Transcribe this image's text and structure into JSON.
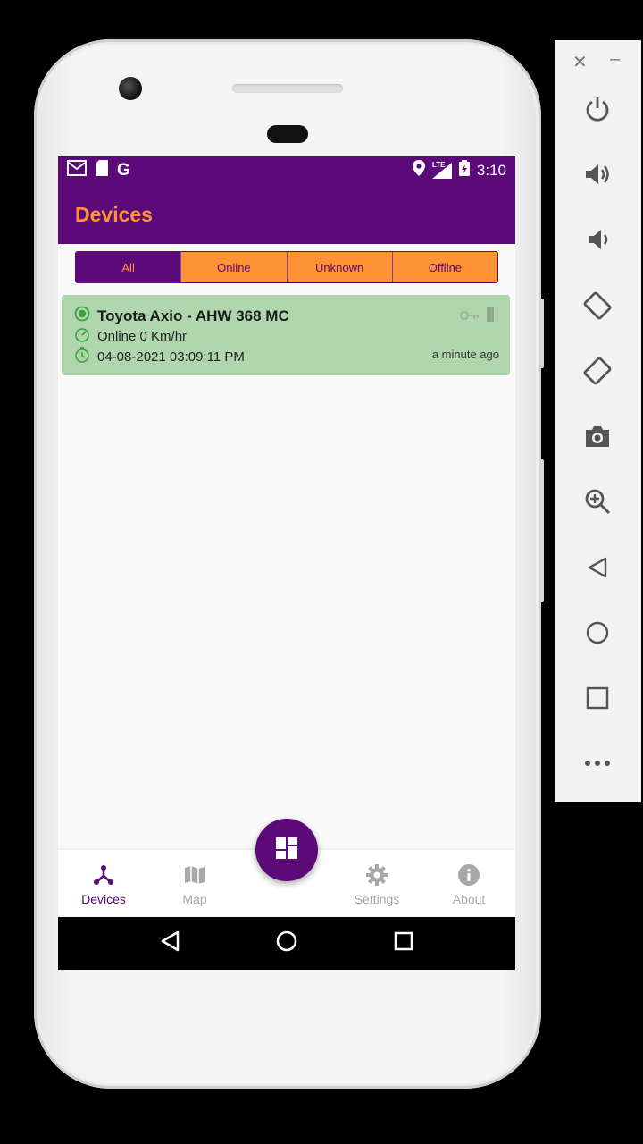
{
  "status_bar": {
    "time": "3:10",
    "network": "LTE"
  },
  "app_bar": {
    "title": "Devices"
  },
  "filters": [
    {
      "label": "All",
      "active": true
    },
    {
      "label": "Online",
      "active": false
    },
    {
      "label": "Unknown",
      "active": false
    },
    {
      "label": "Offline",
      "active": false
    }
  ],
  "devices": [
    {
      "name": "Toyota Axio - AHW 368 MC",
      "status_line": "Online 0 Km/hr",
      "timestamp": "04-08-2021 03:09:11 PM",
      "relative_time": "a minute ago",
      "card_color": "#b0d6ad"
    }
  ],
  "bottom_nav": [
    {
      "label": "Devices",
      "icon": "devices-icon",
      "active": true
    },
    {
      "label": "Map",
      "icon": "map-icon",
      "active": false
    },
    {
      "label": "Settings",
      "icon": "gear-icon",
      "active": false
    },
    {
      "label": "About",
      "icon": "info-icon",
      "active": false
    }
  ],
  "fab": {
    "icon": "dashboard-icon"
  },
  "colors": {
    "primary": "#5c0a7a",
    "accent": "#ff9136",
    "online": "#b0d6ad"
  },
  "emulator_panel": [
    "power-icon",
    "volume-up-icon",
    "volume-down-icon",
    "rotate-left-icon",
    "rotate-right-icon",
    "camera-icon",
    "zoom-icon",
    "back-icon",
    "home-icon",
    "overview-icon",
    "more-icon"
  ]
}
